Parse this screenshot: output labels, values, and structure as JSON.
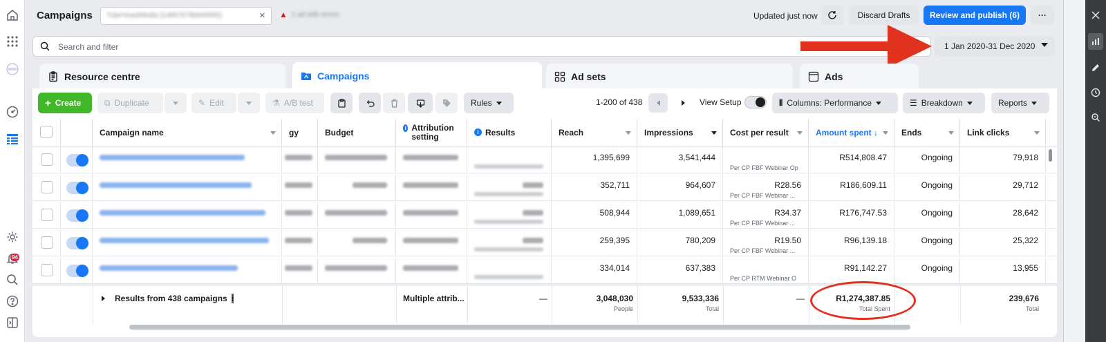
{
  "header": {
    "title": "Campaigns",
    "account_name": "TubeYeastMedia (148676786845955)",
    "warning_text": "1 ad with errors",
    "updated_text": "Updated just now",
    "discard_label": "Discard Drafts",
    "publish_label": "Review and publish (6)",
    "more_label": "···"
  },
  "search": {
    "placeholder": "Search and filter",
    "date_range": "1 Jan 2020-31 Dec 2020"
  },
  "tabs": [
    {
      "label": "Resource centre"
    },
    {
      "label": "Campaigns",
      "active": true
    },
    {
      "label": "Ad sets"
    },
    {
      "label": "Ads"
    }
  ],
  "toolbar": {
    "create": "Create",
    "duplicate": "Duplicate",
    "edit": "Edit",
    "ab_test": "A/B test",
    "rules": "Rules",
    "range": "1-200 of 438",
    "view_setup": "View Setup",
    "columns": "Columns: Performance",
    "breakdown": "Breakdown",
    "reports": "Reports"
  },
  "columns": {
    "campaign_name": "Campaign name",
    "bid_strategy": "gy",
    "budget": "Budget",
    "attribution": "Attribution setting",
    "results": "Results",
    "reach": "Reach",
    "impressions": "Impressions",
    "cost_per_result": "Cost per result",
    "amount_spent": "Amount spent ↓",
    "ends": "Ends",
    "link_clicks": "Link clicks"
  },
  "rows": [
    {
      "reach": "1,395,699",
      "impressions": "3,541,444",
      "cost": "",
      "cost_sub": "Per CP FBF Webinar Op",
      "spent": "R514,808.47",
      "ends": "Ongoing",
      "clicks": "79,918"
    },
    {
      "reach": "352,711",
      "impressions": "964,607",
      "cost": "R28.56",
      "cost_sub": "Per CP FBF Webinar ...",
      "spent": "R186,609.11",
      "ends": "Ongoing",
      "clicks": "29,712"
    },
    {
      "reach": "508,944",
      "impressions": "1,089,651",
      "cost": "R34.37",
      "cost_sub": "Per CP FBF Webinar ...",
      "spent": "R176,747.53",
      "ends": "Ongoing",
      "clicks": "28,642"
    },
    {
      "reach": "259,395",
      "impressions": "780,209",
      "cost": "R19.50",
      "cost_sub": "Per CP FBF Webinar ...",
      "spent": "R96,139.18",
      "ends": "Ongoing",
      "clicks": "25,322"
    },
    {
      "reach": "334,014",
      "impressions": "637,383",
      "cost": "",
      "cost_sub": "Per CP RTM Webinar O",
      "spent": "R91,142.27",
      "ends": "Ongoing",
      "clicks": "13,955"
    }
  ],
  "footer": {
    "label": "Results from 438 campaigns",
    "attribution": "Multiple attrib...",
    "results": "—",
    "reach": "3,048,030",
    "reach_sub": "People",
    "impressions": "9,533,336",
    "impressions_sub": "Total",
    "cost": "—",
    "spent": "R1,274,387.85",
    "spent_sub": "Total Spent",
    "clicks": "239,676",
    "clicks_sub": "Total"
  },
  "rail": {
    "notification_count": "94"
  },
  "colors": {
    "primary": "#1877f2",
    "create": "#42b72a",
    "annotation": "#e0321f"
  }
}
